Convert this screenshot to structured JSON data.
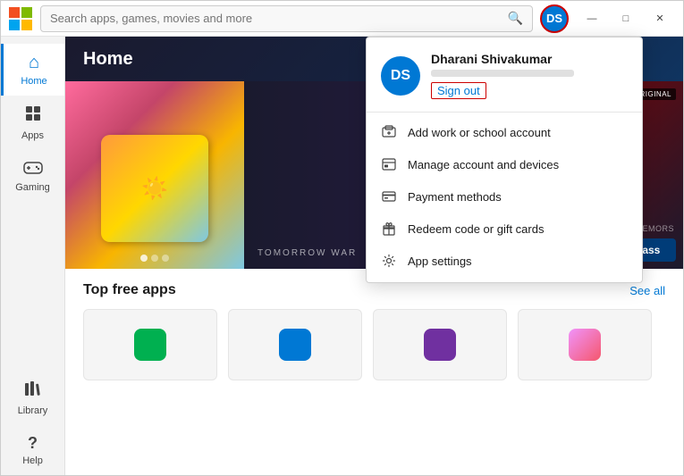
{
  "window": {
    "title": "Microsoft Store",
    "controls": {
      "minimize": "—",
      "maximize": "□",
      "close": "✕"
    }
  },
  "titlebar": {
    "search_placeholder": "Search apps, games, movies and more",
    "search_icon": "🔍",
    "user_initials": "DS"
  },
  "sidebar": {
    "items": [
      {
        "id": "home",
        "label": "Home",
        "icon": "⌂",
        "active": true
      },
      {
        "id": "apps",
        "label": "Apps",
        "icon": "⊞"
      },
      {
        "id": "gaming",
        "label": "Gaming",
        "icon": "🎮"
      },
      {
        "id": "library",
        "label": "Library",
        "icon": "📚"
      },
      {
        "id": "help",
        "label": "Help",
        "icon": "?"
      }
    ]
  },
  "content": {
    "hero_title": "Home",
    "banner": {
      "tomorrow_war": "TOMORROW WAR",
      "amazon_badge": "AMAZON ORIGINAL",
      "out_remorse": "OUT REMORS",
      "pc_game_pass": "PC Game Pass"
    }
  },
  "top_free_apps": {
    "title": "Top free apps",
    "see_all": "See all"
  },
  "dropdown": {
    "user_name": "Dharani Shivakumar",
    "user_initials": "DS",
    "sign_out": "Sign out",
    "menu_items": [
      {
        "id": "add-work",
        "label": "Add work or school account",
        "icon": "🖥"
      },
      {
        "id": "manage-account",
        "label": "Manage account and devices",
        "icon": "📋"
      },
      {
        "id": "payment",
        "label": "Payment methods",
        "icon": "💳"
      },
      {
        "id": "redeem",
        "label": "Redeem code or gift cards",
        "icon": "🎁"
      },
      {
        "id": "settings",
        "label": "App settings",
        "icon": "⚙"
      }
    ]
  },
  "colors": {
    "accent": "#0078d4",
    "signout_border": "#cc0000",
    "sidebar_active": "#0078d4"
  }
}
